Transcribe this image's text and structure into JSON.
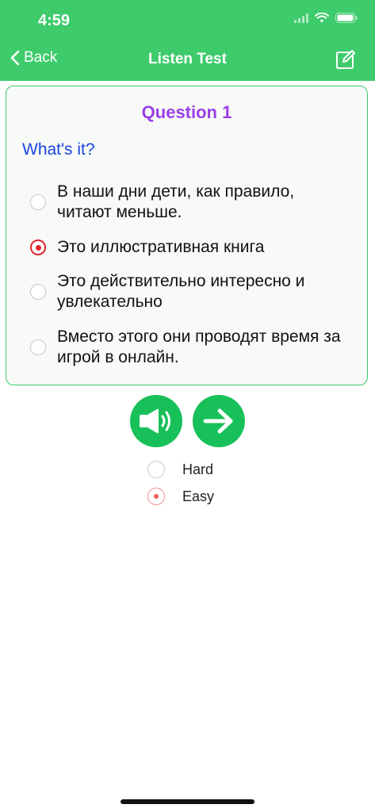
{
  "status_bar": {
    "time": "4:59"
  },
  "nav": {
    "back_label": "Back",
    "title": "Listen Test",
    "edit_icon": "edit-icon"
  },
  "question": {
    "title": "Question 1",
    "prompt": "What's it?",
    "options": [
      {
        "text": "В наши дни дети, как правило, читают меньше.",
        "selected": false
      },
      {
        "text": "Это иллюстративная книга",
        "selected": true
      },
      {
        "text": "Это действительно интересно и увлекательно",
        "selected": false
      },
      {
        "text": "Вместо этого они проводят время за игрой в онлайн.",
        "selected": false
      }
    ]
  },
  "controls": {
    "play_icon": "speaker-icon",
    "next_icon": "arrow-right-icon"
  },
  "difficulty": {
    "options": [
      {
        "label": "Hard",
        "selected": false
      },
      {
        "label": "Easy",
        "selected": true
      }
    ]
  },
  "colors": {
    "brand_green": "#3ecb6b",
    "button_green": "#18c05a",
    "question_purple": "#9b3ee8",
    "prompt_blue": "#1a44e0",
    "selected_red": "#e0242b"
  }
}
